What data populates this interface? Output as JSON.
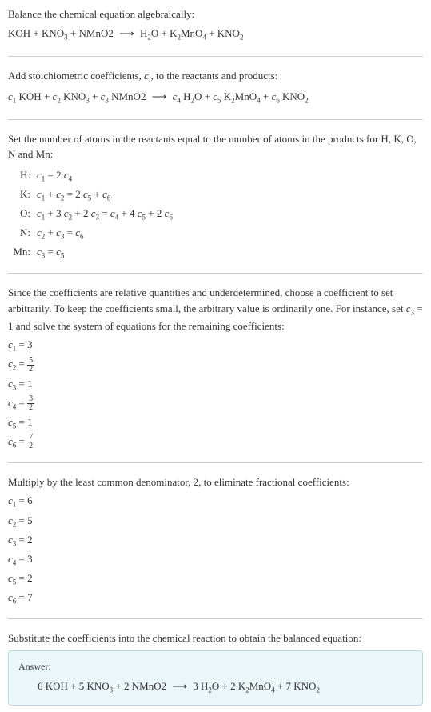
{
  "section1": {
    "title": "Balance the chemical equation algebraically:",
    "equation": "KOH + KNO₃ + NMnO2  ⟶  H₂O + K₂MnO₄ + KNO₂"
  },
  "section2": {
    "title_part1": "Add stoichiometric coefficients, ",
    "title_ci": "cᵢ",
    "title_part2": ", to the reactants and products:",
    "equation": "c₁ KOH + c₂ KNO₃ + c₃ NMnO2  ⟶  c₄ H₂O + c₅ K₂MnO₄ + c₆ KNO₂"
  },
  "section3": {
    "title": "Set the number of atoms in the reactants equal to the number of atoms in the products for H, K, O, N and Mn:",
    "rows": [
      {
        "label": "H:",
        "eq": "c₁ = 2 c₄"
      },
      {
        "label": "K:",
        "eq": "c₁ + c₂ = 2 c₅ + c₆"
      },
      {
        "label": "O:",
        "eq": "c₁ + 3 c₂ + 2 c₃ = c₄ + 4 c₅ + 2 c₆"
      },
      {
        "label": "N:",
        "eq": "c₂ + c₃ = c₆"
      },
      {
        "label": "Mn:",
        "eq": "c₃ = c₅"
      }
    ]
  },
  "section4": {
    "title": "Since the coefficients are relative quantities and underdetermined, choose a coefficient to set arbitrarily. To keep the coefficients small, the arbitrary value is ordinarily one. For instance, set c₃ = 1 and solve the system of equations for the remaining coefficients:",
    "coefs": [
      {
        "lhs": "c₁",
        "rhs": "3",
        "frac": null
      },
      {
        "lhs": "c₂",
        "rhs": null,
        "frac": {
          "num": "5",
          "den": "2"
        }
      },
      {
        "lhs": "c₃",
        "rhs": "1",
        "frac": null
      },
      {
        "lhs": "c₄",
        "rhs": null,
        "frac": {
          "num": "3",
          "den": "2"
        }
      },
      {
        "lhs": "c₅",
        "rhs": "1",
        "frac": null
      },
      {
        "lhs": "c₆",
        "rhs": null,
        "frac": {
          "num": "7",
          "den": "2"
        }
      }
    ]
  },
  "section5": {
    "title": "Multiply by the least common denominator, 2, to eliminate fractional coefficients:",
    "coefs": [
      {
        "lhs": "c₁",
        "rhs": "6"
      },
      {
        "lhs": "c₂",
        "rhs": "5"
      },
      {
        "lhs": "c₃",
        "rhs": "2"
      },
      {
        "lhs": "c₄",
        "rhs": "3"
      },
      {
        "lhs": "c₅",
        "rhs": "2"
      },
      {
        "lhs": "c₆",
        "rhs": "7"
      }
    ]
  },
  "section6": {
    "title": "Substitute the coefficients into the chemical reaction to obtain the balanced equation:",
    "answer_label": "Answer:",
    "answer_eq": "6 KOH + 5 KNO₃ + 2 NMnO2  ⟶  3 H₂O + 2 K₂MnO₄ + 7 KNO₂"
  }
}
